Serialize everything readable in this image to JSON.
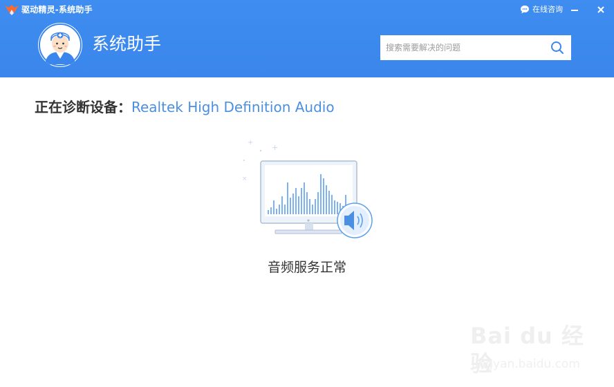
{
  "window": {
    "app_title": "驱动精灵-系统助手",
    "consult_label": "在线咨询"
  },
  "header": {
    "title": "系统助手",
    "search_placeholder": "搜索需要解决的问题"
  },
  "diagnosis": {
    "label": "正在诊断设备：",
    "device": "Realtek High Definition Audio"
  },
  "status": {
    "text": "音频服务正常"
  },
  "watermark": {
    "brand": "Bai du 经验",
    "url": "jingyan.baidu.com"
  },
  "colors": {
    "header_blue": "#3a86ec",
    "accent_blue": "#4a8fe0"
  },
  "icons": [
    "app-logo-icon",
    "chat-bubble-icon",
    "minimize-icon",
    "close-icon",
    "doctor-avatar-icon",
    "search-icon",
    "monitor-icon",
    "speaker-icon"
  ]
}
